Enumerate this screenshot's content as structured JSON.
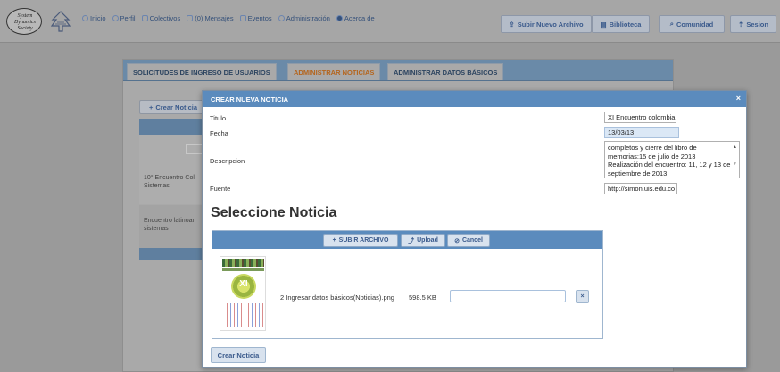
{
  "brand": {
    "logo_lines": [
      "System",
      "Dynamics",
      "Society"
    ],
    "logo_icon": "tree-icon"
  },
  "nav": {
    "items": [
      {
        "label": "Inicio",
        "icon": "home-icon"
      },
      {
        "label": "Perfil",
        "icon": "person-icon"
      },
      {
        "label": "Colectivos",
        "icon": "group-icon"
      },
      {
        "label": "(0) Mensajes",
        "icon": "mail-icon"
      },
      {
        "label": "Eventos",
        "icon": "calendar-icon"
      },
      {
        "label": "Administración",
        "icon": "gear-icon"
      },
      {
        "label": "Acerca de",
        "icon": "info-icon"
      }
    ]
  },
  "top_buttons": {
    "upload": "Subir Nuevo Archivo",
    "library": "Biblioteca",
    "community": "Comunidad",
    "session": "Sesion"
  },
  "tabs": [
    {
      "label": "SOLICITUDES DE INGRESO DE USUARIOS",
      "active": false
    },
    {
      "label": "ADMINISTRAR NOTICIAS",
      "active": true
    },
    {
      "label": "ADMINISTRAR DATOS BÁSICOS",
      "active": false
    }
  ],
  "background": {
    "create_button": "Crear Noticia",
    "rows": [
      "10° Encuentro Col\nSistemas",
      "Encuentro latinoar\nsistemas"
    ]
  },
  "modal": {
    "title": "CREAR NUEVA NOTICIA",
    "close": "×",
    "fields": {
      "titulo_label": "Titulo",
      "titulo_value": "XI Encuentro colombia",
      "fecha_label": "Fecha",
      "fecha_value": "13/03/13",
      "descripcion_label": "Descripcion",
      "descripcion_value": "completos y cierre del libro de memorias:15 de julio de 2013\nRealización del encuentro: 11, 12 y 13 de septiembre de 2013",
      "fuente_label": "Fuente",
      "fuente_value": "http://simon.uis.edu.co"
    },
    "section_title": "Seleccione Noticia",
    "uploader": {
      "subir_archivo": "SUBIR ARCHIVO",
      "upload": "Upload",
      "cancel": "Cancel",
      "file": {
        "name": "2 Ingresar datos básicos(Noticias).png",
        "size": "598.5 KB",
        "thumb_text": "XI",
        "remove": "×"
      }
    },
    "create_button": "Crear Noticia"
  },
  "colors": {
    "accent": "#5b8bbd",
    "active_tab": "#b5651d",
    "overlay": "#9a9a9a"
  }
}
